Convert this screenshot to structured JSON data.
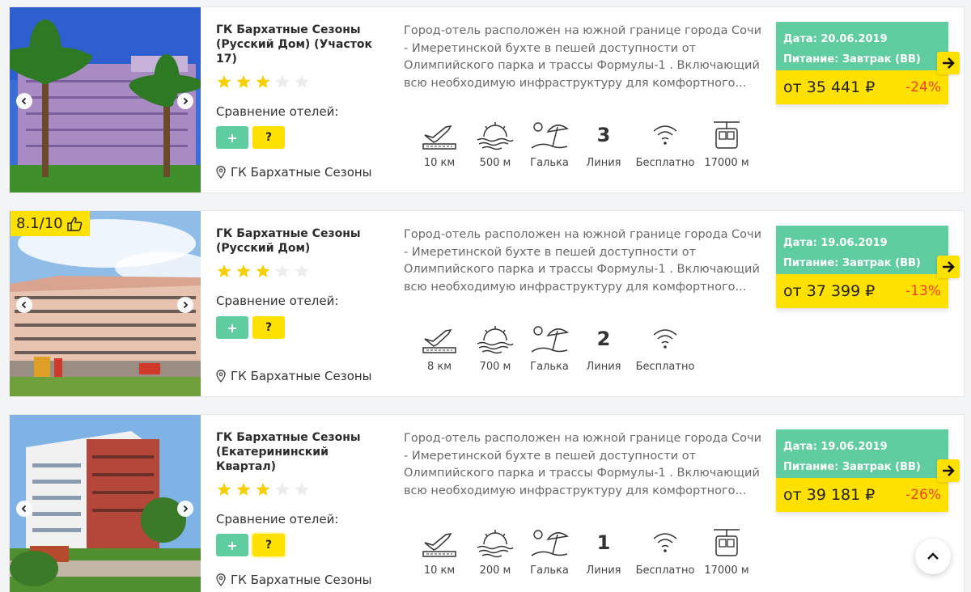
{
  "compare_label": "Сравнение отелей:",
  "add_label": "+",
  "help_label": "?",
  "colors": {
    "accent_green": "#5fcda0",
    "accent_yellow": "#ffe100",
    "discount_red": "#f0412f"
  },
  "hotels": [
    {
      "title": "ГК Бархатные Сезоны (Русский Дом) (Участок 17)",
      "stars": 3,
      "stars_max": 5,
      "location": "ГК Бархатные Сезоны",
      "description": "Город-отель расположен на южной границе города Сочи - Имеретинской бухте в пешей доступности от Олимпийского парка и трассы Формулы-1 . Включающий всю необходимую инфраструктуру для комфортного...",
      "rating": "",
      "amenities": {
        "airport": "10 км",
        "sea": "500 м",
        "beach": "Галька",
        "line_number": "3",
        "line_label": "Линия",
        "wifi": "Бесплатно",
        "cable_car": "17000 м"
      },
      "date": "Дата: 20.06.2019",
      "meal": "Питание: Завтрак (BB)",
      "price": "от 35 441 ₽",
      "discount": "-24%"
    },
    {
      "title": "ГК Бархатные Сезоны (Русский Дом)",
      "stars": 3,
      "stars_max": 5,
      "location": "ГК Бархатные Сезоны",
      "description": "Город-отель расположен на южной границе города Сочи - Имеретинской бухте в пешей доступности от Олимпийского парка и трассы Формулы-1 . Включающий всю необходимую инфраструктуру для комфортного...",
      "rating": "8.1/10",
      "amenities": {
        "airport": "8 км",
        "sea": "700 м",
        "beach": "Галька",
        "line_number": "2",
        "line_label": "Линия",
        "wifi": "Бесплатно"
      },
      "date": "Дата: 19.06.2019",
      "meal": "Питание: Завтрак (BB)",
      "price": "от 37 399 ₽",
      "discount": "-13%"
    },
    {
      "title": "ГК Бархатные Сезоны (Екатерининский Квартал)",
      "stars": 3,
      "stars_max": 5,
      "location": "ГК Бархатные Сезоны",
      "description": "Город-отель расположен на южной границе города Сочи - Имеретинской бухте в пешей доступности от Олимпийского парка и трассы Формулы-1 . Включающий всю необходимую инфраструктуру для комфортного...",
      "rating": "",
      "amenities": {
        "airport": "10 км",
        "sea": "200 м",
        "beach": "Галька",
        "line_number": "1",
        "line_label": "Линия",
        "wifi": "Бесплатно",
        "cable_car": "17000 м"
      },
      "date": "Дата: 19.06.2019",
      "meal": "Питание: Завтрак (BB)",
      "price": "от 39 181 ₽",
      "discount": "-26%"
    }
  ]
}
